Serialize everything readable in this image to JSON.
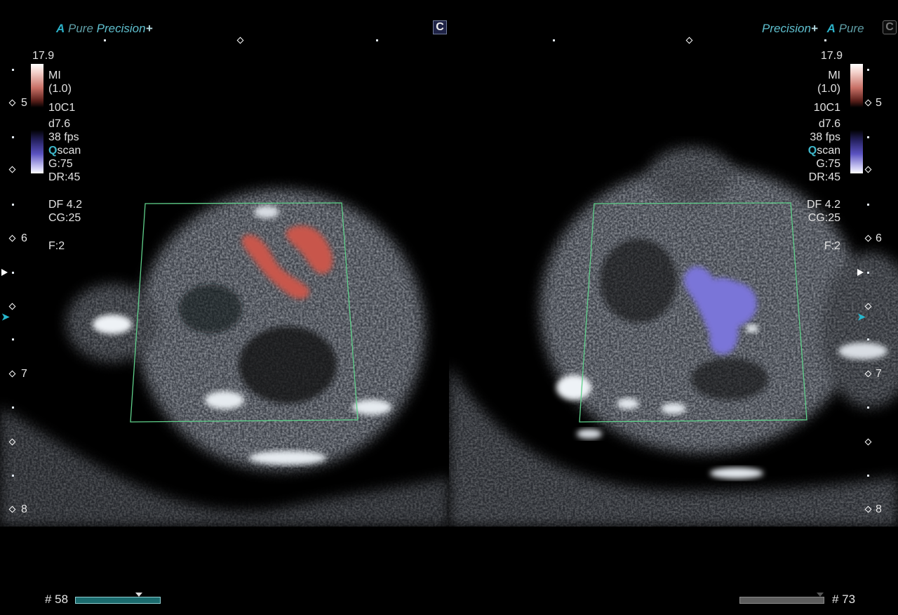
{
  "left_panel": {
    "brand": {
      "a": "A",
      "pure": "Pure",
      "precision": "Precision",
      "plus": "+"
    },
    "mode_badge": "C",
    "scale_max": "17.9",
    "mi_label": "MI",
    "mi_value": "(1.0)",
    "probe": "10C1",
    "depth_setting": "d7.6",
    "fps": "38 fps",
    "qscan_q": "Q",
    "qscan_rest": "scan",
    "gain": "G:75",
    "dynamic_range": "DR:45",
    "doppler_frequency": "DF 4.2",
    "color_gain": "CG:25",
    "frame_filter": "F:2",
    "frame_number": "# 58",
    "depth_marks": [
      "5",
      "6",
      "7",
      "8"
    ],
    "flow_color": "#c8574c"
  },
  "right_panel": {
    "brand": {
      "precision": "Precision",
      "plus": "+",
      "a": "A",
      "pure": "Pure"
    },
    "mode_badge": "C",
    "scale_max": "17.9",
    "mi_label": "MI",
    "mi_value": "(1.0)",
    "probe": "10C1",
    "depth_setting": "d7.6",
    "fps": "38 fps",
    "qscan_q": "Q",
    "qscan_rest": "scan",
    "gain": "G:75",
    "dynamic_range": "DR:45",
    "doppler_frequency": "DF 4.2",
    "color_gain": "CG:25",
    "frame_filter": "F:2",
    "frame_number": "# 73",
    "depth_marks": [
      "5",
      "6",
      "7",
      "8"
    ],
    "flow_color": "#7a74d8"
  },
  "colors": {
    "roi_box": "#5fd08a",
    "accent_cyan": "#2bb1c8",
    "cine_left": "#1b6b6e",
    "cine_right": "#5d5d5d"
  }
}
